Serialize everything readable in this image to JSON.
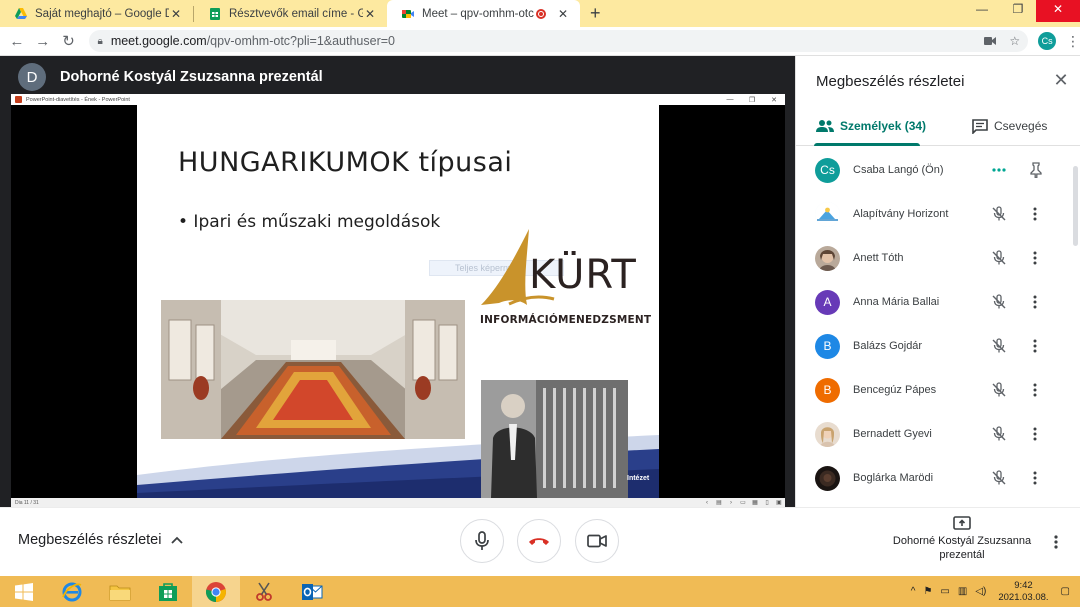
{
  "browser": {
    "tabs": [
      {
        "title": "Saját meghajtó – Google Drive",
        "icon": "google-drive-icon",
        "active": false
      },
      {
        "title": "Résztvevők email címe - Google",
        "icon": "google-sheets-icon",
        "active": false
      },
      {
        "title": "Meet – qpv-omhm-otc",
        "icon": "google-meet-icon",
        "active": true,
        "recording": true
      }
    ],
    "new_tab_label": "+",
    "url_host": "meet.google.com",
    "url_path": "/qpv-omhm-otc?pli=1&authuser=0",
    "profile_initials": "Cs"
  },
  "presenter": {
    "avatar_initial": "D",
    "label": "Dohorné Kostyál Zsuzsanna prezentál"
  },
  "powerpoint": {
    "window_title": "PowerPoint-diavetítés - Ének - PowerPoint",
    "status_left": "Dia 11 / 31",
    "slide": {
      "title": "HUNGARIKUMOK típusai",
      "bullet": "• Ipari és műszaki megoldások",
      "watermark": "Teljes képernyő",
      "logo_text": "KÜRT",
      "logo_subtitle": "INFORMÁCIÓMENEDZSMENT",
      "corner_label": "Intézet"
    }
  },
  "sidebar": {
    "title": "Megbeszélés részletei",
    "tab_people": "Személyek (34)",
    "tab_chat": "Csevegés",
    "participants": [
      {
        "name": "Csaba Langó (Ön)",
        "initials": "Cs",
        "color": "#0f9d9a",
        "kind": "initials",
        "self": true
      },
      {
        "name": "Alapítvány Horizont",
        "initials": "",
        "color": "#e8f4fb",
        "kind": "logo"
      },
      {
        "name": "Anett Tóth",
        "initials": "",
        "color": "#8d7c70",
        "kind": "photo"
      },
      {
        "name": "Anna Mária Ballai",
        "initials": "A",
        "color": "#673ab7",
        "kind": "initials"
      },
      {
        "name": "Balázs Gojdár",
        "initials": "B",
        "color": "#1e88e5",
        "kind": "initials"
      },
      {
        "name": "Bencegúz Pápes",
        "initials": "B",
        "color": "#ef6c00",
        "kind": "initials"
      },
      {
        "name": "Bernadett Gyevi",
        "initials": "",
        "color": "#c9a88c",
        "kind": "photo"
      },
      {
        "name": "Boglárka Marödi",
        "initials": "",
        "color": "#3a2a22",
        "kind": "photo"
      }
    ]
  },
  "bottombar": {
    "details_label": "Megbeszélés részletei",
    "present_label": "Dohorné Kostyál Zsuzsanna prezentál"
  },
  "taskbar": {
    "time": "9:42",
    "date": "2021.03.08."
  },
  "colors": {
    "meet_teal": "#00796b",
    "hangup_red": "#d93025",
    "taskbar": "#f0bb55",
    "tabstrip": "#fde9a0"
  }
}
